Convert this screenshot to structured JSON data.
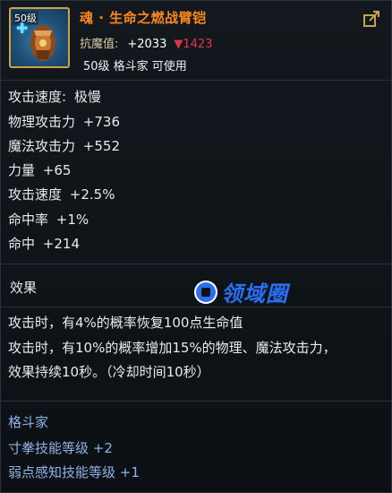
{
  "header": {
    "level_badge": "50级",
    "title": "魂 · 生命之燃战臂铠",
    "resist_label": "抗魔值:",
    "resist_value": "+2033",
    "resist_delta": "1423",
    "requirement": "50级 格斗家 可使用"
  },
  "attributes": [
    {
      "label": "攻击速度:",
      "value": "极慢"
    },
    {
      "label": "物理攻击力",
      "value": "+736"
    },
    {
      "label": "魔法攻击力",
      "value": "+552"
    },
    {
      "label": "力量",
      "value": "+65"
    },
    {
      "label": "攻击速度",
      "value": "+2.5%"
    },
    {
      "label": "命中率",
      "value": "+1%"
    },
    {
      "label": "命中",
      "value": "+214"
    }
  ],
  "effect": {
    "title": "效果",
    "lines": [
      "攻击时，有4%的概率恢复100点生命值",
      "攻击时，有10%的概率增加15%的物理、魔法攻击力，",
      "效果持续10秒。（冷却时间10秒）"
    ]
  },
  "watermark": {
    "text": "领域圈"
  },
  "class_bonus": {
    "title": "格斗家",
    "skills": [
      "寸拳技能等级 +2",
      "弱点感知技能等级 +1"
    ]
  },
  "colors": {
    "title": "#ff8a1f",
    "down": "#e0364a",
    "class": "#8fb2e6",
    "watermark": "#2b6ff6"
  }
}
